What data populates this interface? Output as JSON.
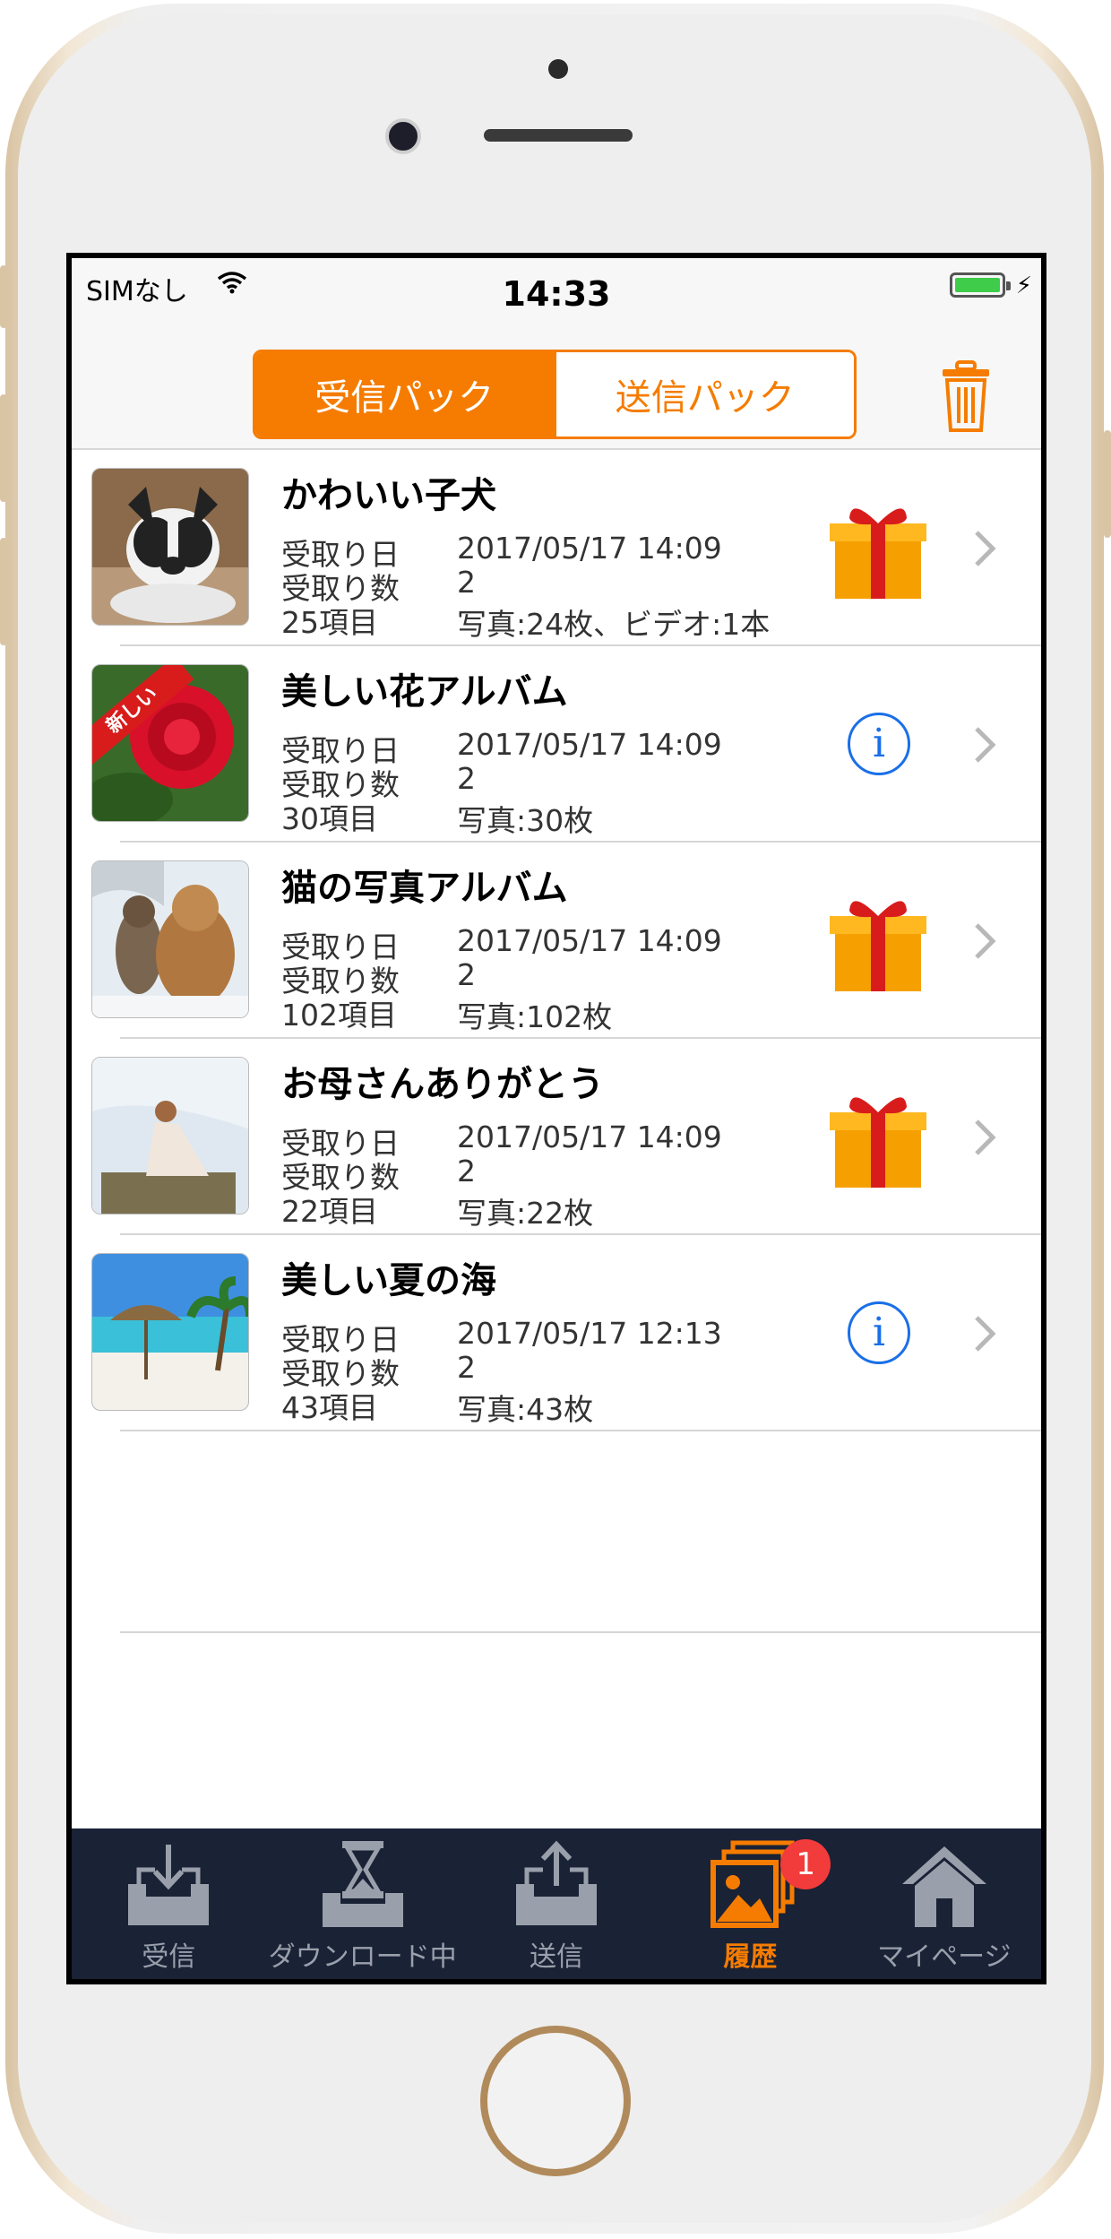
{
  "status_bar": {
    "carrier": "SIMなし",
    "time": "14:33",
    "icons": [
      "wifi-icon",
      "battery-icon",
      "charging-bolt-icon"
    ]
  },
  "header": {
    "segments": [
      {
        "label": "受信パック",
        "selected": true
      },
      {
        "label": "送信パック",
        "selected": false
      }
    ],
    "trash_icon": "trash-icon"
  },
  "labels": {
    "received_date": "受取り日",
    "received_count": "受取り数"
  },
  "list": {
    "items": [
      {
        "title": "かわいい子犬",
        "date": "2017/05/17 14:09",
        "count": "2",
        "items_text": "25項目",
        "detail": "写真:24枚、ビデオ:1本",
        "action_icon": "gift-icon",
        "thumb": "french-bulldog-photo",
        "new_ribbon": ""
      },
      {
        "title": "美しい花アルバム",
        "date": "2017/05/17 14:09",
        "count": "2",
        "items_text": "30項目",
        "detail": "写真:30枚",
        "action_icon": "info-icon",
        "thumb": "red-rose-photo",
        "new_ribbon": "新しい"
      },
      {
        "title": "猫の写真アルバム",
        "date": "2017/05/17 14:09",
        "count": "2",
        "items_text": "102項目",
        "detail": "写真:102枚",
        "action_icon": "gift-icon",
        "thumb": "cats-in-snow-photo",
        "new_ribbon": ""
      },
      {
        "title": "お母さんありがとう",
        "date": "2017/05/17 14:09",
        "count": "2",
        "items_text": "22項目",
        "detail": "写真:22枚",
        "action_icon": "gift-icon",
        "thumb": "woman-on-rock-photo",
        "new_ribbon": ""
      },
      {
        "title": "美しい夏の海",
        "date": "2017/05/17 12:13",
        "count": "2",
        "items_text": "43項目",
        "detail": "写真:43枚",
        "action_icon": "info-icon",
        "thumb": "beach-photo",
        "new_ribbon": ""
      }
    ]
  },
  "tabbar": {
    "tabs": [
      {
        "label": "受信",
        "icon": "inbox-download-icon",
        "active": false
      },
      {
        "label": "ダウンロード中",
        "icon": "hourglass-icon",
        "active": false
      },
      {
        "label": "送信",
        "icon": "outbox-upload-icon",
        "active": false
      },
      {
        "label": "履歴",
        "icon": "history-photos-icon",
        "active": true,
        "badge": "1"
      },
      {
        "label": "マイページ",
        "icon": "home-icon",
        "active": false
      }
    ]
  },
  "colors": {
    "accent": "#f57c00",
    "tabbar_bg": "#1a2236",
    "info_blue": "#1a6fe8",
    "badge_red": "#f23b3b"
  }
}
